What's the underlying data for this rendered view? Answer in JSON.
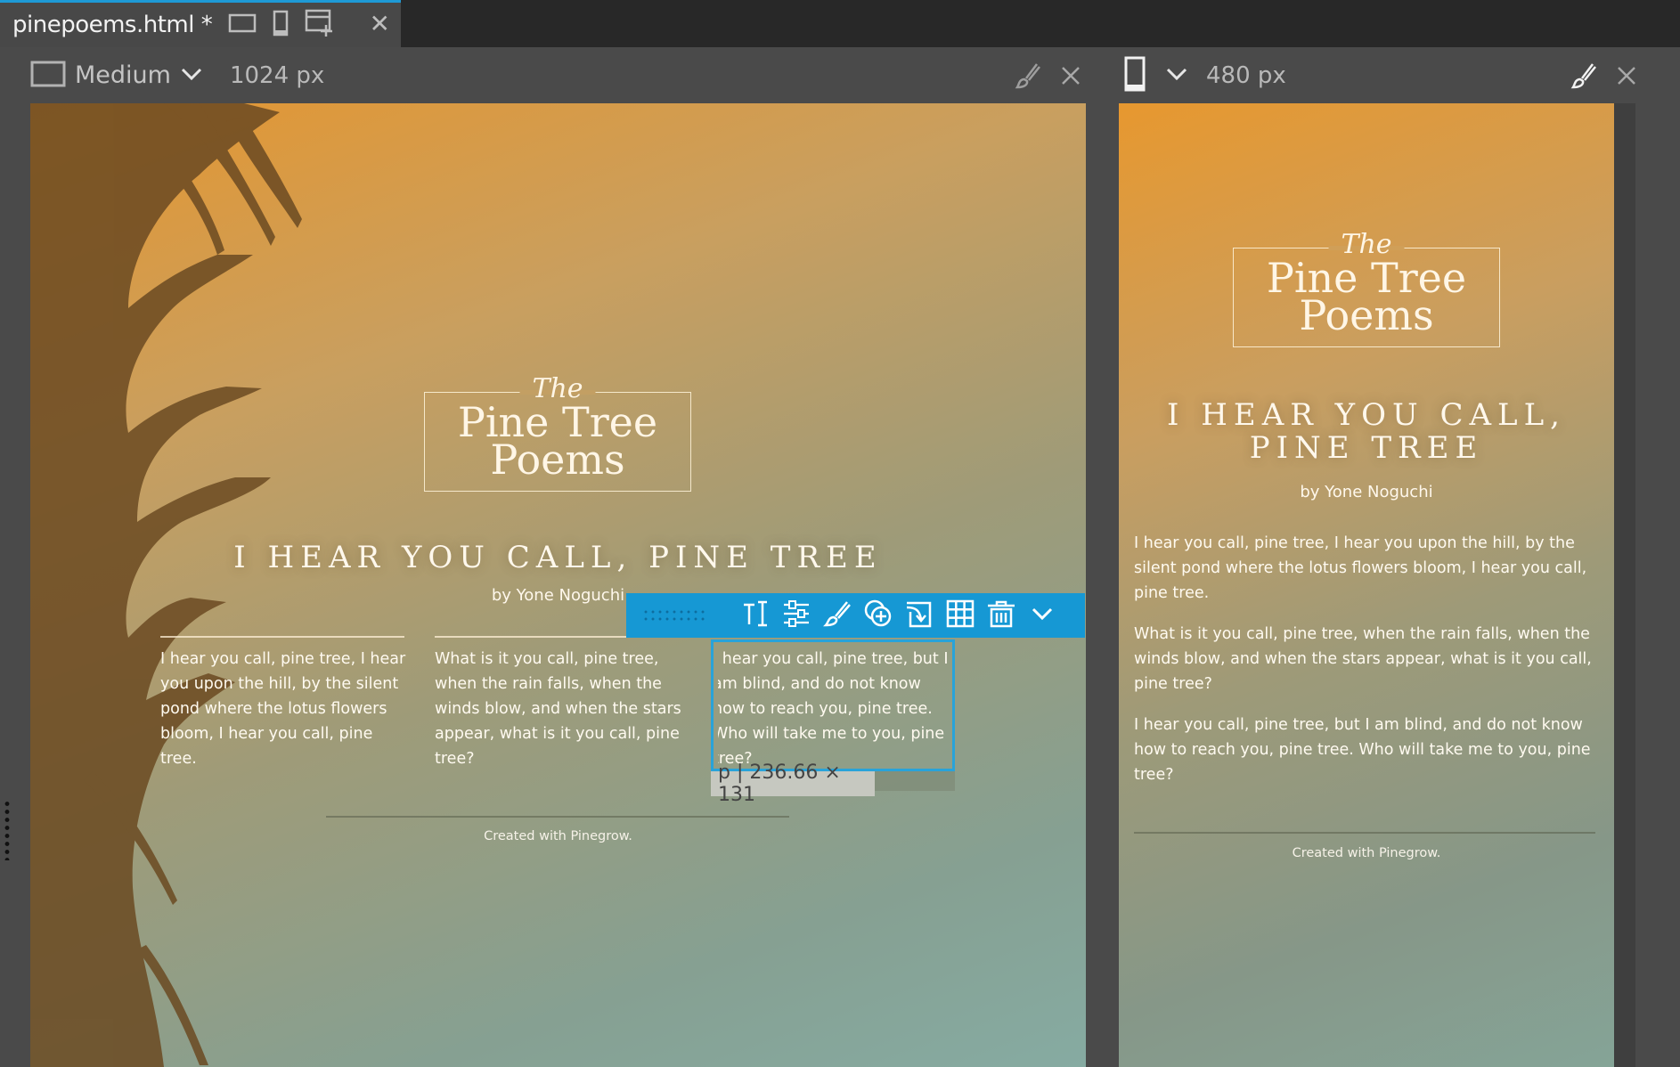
{
  "tab": {
    "title": "pinepoems.html *"
  },
  "left_pane": {
    "size_name": "Medium",
    "width_label": "1024 px"
  },
  "right_pane": {
    "width_label": "480 px"
  },
  "page": {
    "logo_the": "The",
    "logo_line1": "Pine Tree",
    "logo_line2": "Poems",
    "headline": "I HEAR YOU CALL, PINE TREE",
    "headline_line1": "I HEAR YOU CALL,",
    "headline_line2": "PINE TREE",
    "byline": "by Yone Noguchi",
    "paragraphs": [
      "I hear you call, pine tree, I hear you upon the hill, by the silent pond where the lotus flowers bloom, I hear you call, pine tree.",
      "What is it you call, pine tree, when the rain falls, when the winds blow, and when the stars appear, what is it you call, pine tree?",
      "I hear you call, pine tree, but I am blind, and do not know how to reach you, pine tree. Who will take me to you, pine tree?"
    ],
    "footer": "Created with Pinegrow."
  },
  "selection": {
    "label": "p | 236.66 × 131"
  },
  "element_toolbar": {
    "icons": [
      "text-edit-icon",
      "sliders-icon",
      "brush-icon",
      "add-icon",
      "insert-into-icon",
      "grid-icon",
      "trash-icon",
      "chevron-down-icon"
    ]
  },
  "colors": {
    "accent": "#1698d4",
    "selection": "#29a3d9",
    "tab_bar": "#282828",
    "panel": "#4a4a4a"
  }
}
